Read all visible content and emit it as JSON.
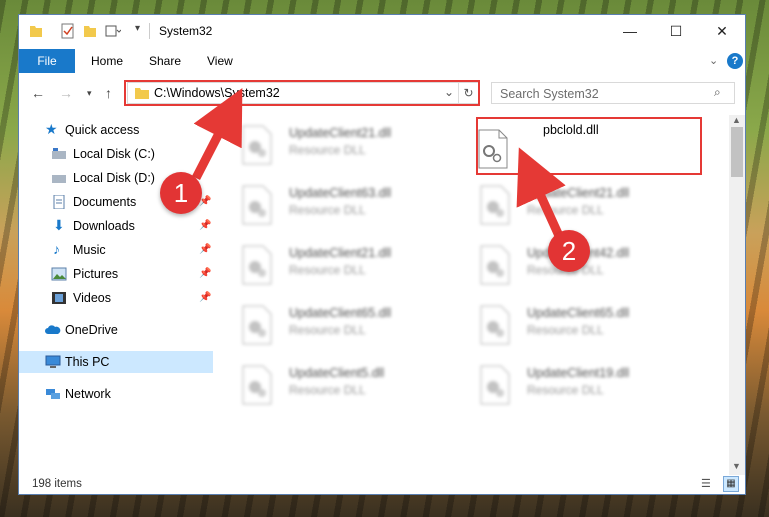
{
  "window": {
    "title": "System32"
  },
  "ribbon": {
    "file": "File",
    "home": "Home",
    "share": "Share",
    "view": "View"
  },
  "address": {
    "path": "C:\\Windows\\System32"
  },
  "search": {
    "placeholder": "Search System32"
  },
  "nav": {
    "quick_access": "Quick access",
    "items": [
      {
        "label": "Local Disk (C:)",
        "icon": "drive-icon",
        "pinned": false
      },
      {
        "label": "Local Disk (D:)",
        "icon": "drive-icon",
        "pinned": false
      },
      {
        "label": "Documents",
        "icon": "documents-icon",
        "pinned": true
      },
      {
        "label": "Downloads",
        "icon": "downloads-icon",
        "pinned": true
      },
      {
        "label": "Music",
        "icon": "music-icon",
        "pinned": true
      },
      {
        "label": "Pictures",
        "icon": "pictures-icon",
        "pinned": true
      },
      {
        "label": "Videos",
        "icon": "videos-icon",
        "pinned": true
      }
    ],
    "onedrive": "OneDrive",
    "this_pc": "This PC",
    "network": "Network"
  },
  "files": {
    "highlighted": {
      "name": "pbclold.dll"
    },
    "col1": [
      {
        "name": "UpdateClient21.dll",
        "type": "Resource DLL"
      },
      {
        "name": "UpdateClient63.dll",
        "type": "Resource DLL"
      },
      {
        "name": "UpdateClient21.dll",
        "type": "Resource DLL"
      },
      {
        "name": "UpdateClient65.dll",
        "type": "Resource DLL"
      },
      {
        "name": "UpdateClient5.dll",
        "type": "Resource DLL"
      }
    ],
    "col2": [
      {
        "name": "UpdateClient21.dll",
        "type": "Resource DLL"
      },
      {
        "name": "UpdateClient42.dll",
        "type": "Resource DLL"
      },
      {
        "name": "UpdateClient65.dll",
        "type": "Resource DLL"
      },
      {
        "name": "UpdateClient19.dll",
        "type": "Resource DLL"
      }
    ]
  },
  "status": {
    "count": "198 items"
  },
  "annotations": {
    "step1": "1",
    "step2": "2",
    "color": "#e53935"
  }
}
